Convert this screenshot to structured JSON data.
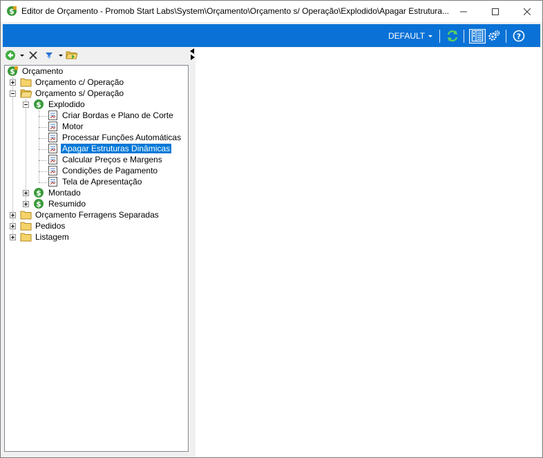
{
  "window": {
    "title": "Editor de Orçamento - Promob Start Labs\\System\\Orçamento\\Orçamento s/ Operação\\Explodido\\Apagar Estrutura...",
    "icon": "budget-dollar-icon"
  },
  "ribbon": {
    "background": "#0a72d6",
    "profile_label": "DEFAULT",
    "icons": [
      "refresh-icon",
      "layout-panel-icon",
      "settings-gears-icon",
      "help-icon"
    ]
  },
  "tree_toolbar": {
    "icons": [
      "back-arrow-icon",
      "delete-x-icon",
      "move-down-icon",
      "folder-open-icon"
    ]
  },
  "tree": {
    "root": "Orçamento",
    "nodes": [
      {
        "label": "Orçamento c/ Operação",
        "icon": "folder-icon",
        "expanded": false
      },
      {
        "label": "Orçamento s/ Operação",
        "icon": "folder-open-icon",
        "expanded": true
      },
      {
        "label": "Explodido",
        "icon": "dollar-icon",
        "expanded": true
      },
      {
        "label": "Criar Bordas e Plano de Corte",
        "icon": "script-icon"
      },
      {
        "label": "Motor",
        "icon": "script-icon"
      },
      {
        "label": "Processar Funções Automáticas",
        "icon": "script-icon"
      },
      {
        "label": "Apagar Estruturas Dinâmicas",
        "icon": "script-icon",
        "selected": true
      },
      {
        "label": "Calcular Preços e Margens",
        "icon": "script-icon"
      },
      {
        "label": "Condições de Pagamento",
        "icon": "script-icon"
      },
      {
        "label": "Tela de Apresentação",
        "icon": "script-icon"
      },
      {
        "label": "Montado",
        "icon": "dollar-icon",
        "expanded": false
      },
      {
        "label": "Resumido",
        "icon": "dollar-icon",
        "expanded": false
      },
      {
        "label": "Orçamento Ferragens Separadas",
        "icon": "folder-icon",
        "expanded": false
      },
      {
        "label": "Pedidos",
        "icon": "folder-icon",
        "expanded": false
      },
      {
        "label": "Listagem",
        "icon": "folder-icon",
        "expanded": false
      }
    ]
  },
  "colors": {
    "accent": "#0a72d6",
    "selection": "#0078d7",
    "folder": "#f5d36a",
    "dollar": "#3a9a3a"
  }
}
